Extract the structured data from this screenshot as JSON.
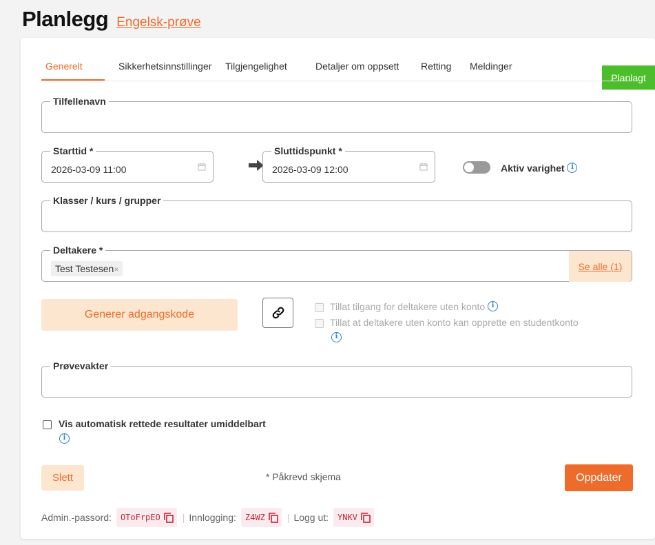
{
  "header": {
    "title": "Planlegg",
    "subtitle": "Engelsk-prøve"
  },
  "status": "Planlagt",
  "tabs": [
    {
      "label": "Generelt",
      "active": true
    },
    {
      "label": "Sikkerhetsinnstillinger",
      "active": false
    },
    {
      "label": "Tilgjengelighet",
      "active": false
    },
    {
      "label": "Detaljer om oppsett",
      "active": false
    },
    {
      "label": "Retting",
      "active": false
    },
    {
      "label": "Meldinger",
      "active": false
    }
  ],
  "form": {
    "instance_name": {
      "label": "Tilfellenavn",
      "value": ""
    },
    "start": {
      "label": "Starttid *",
      "value": "2026-03-09 11:00"
    },
    "end": {
      "label": "Sluttidspunkt *",
      "value": "2026-03-09 12:00"
    },
    "active_duration": {
      "label": "Aktiv varighet",
      "enabled": false
    },
    "classes": {
      "label": "Klasser / kurs / grupper",
      "value": ""
    },
    "participants": {
      "label": "Deltakere *",
      "chips": [
        "Test Testesen"
      ],
      "see_all": "Se alle (1)"
    },
    "generate_code_label": "Generer adgangskode",
    "allow_no_account": {
      "label": "Tillat tilgang for deltakere uten konto",
      "checked": false,
      "disabled": true
    },
    "allow_create_account": {
      "label": "Tillat at deltakere uten konto kan opprette en studentkonto",
      "checked": false,
      "disabled": true
    },
    "proctors": {
      "label": "Prøvevakter",
      "value": ""
    },
    "show_results": {
      "label": "Vis automatisk rettede resultater umiddelbart",
      "checked": false
    }
  },
  "actions": {
    "delete": "Slett",
    "required_note": "* Påkrevd skjema",
    "update": "Oppdater"
  },
  "footer": {
    "admin_label": "Admin.-passord:",
    "admin_code": "OToFrpEO",
    "login_label": "Innlogging:",
    "login_code": "Z4WZ",
    "logout_label": "Logg ut:",
    "logout_code": "YNKV"
  },
  "colors": {
    "accent": "#ee6c2b",
    "status_green": "#4cbe2b",
    "info_blue": "#2b7ddd",
    "code_red": "#c0263c"
  },
  "icons": [
    "calendar-icon",
    "arrow-right-icon",
    "info-icon",
    "link-icon",
    "copy-icon",
    "close-icon"
  ]
}
